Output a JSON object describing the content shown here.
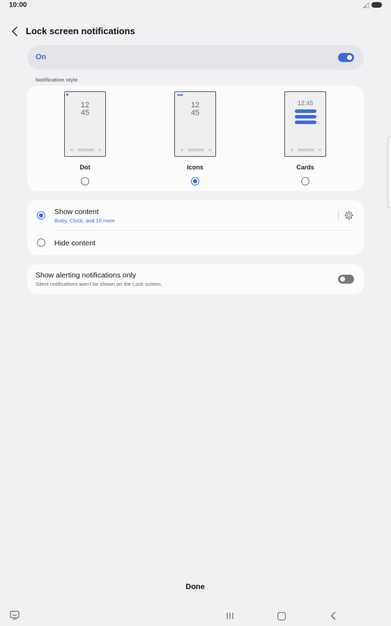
{
  "status_bar": {
    "time": "10:00"
  },
  "header": {
    "title": "Lock screen notifications"
  },
  "master_toggle": {
    "label": "On",
    "state": "on"
  },
  "notification_style": {
    "section_label": "Notification style",
    "options": [
      {
        "label": "Dot",
        "selected": false,
        "preview_clock": [
          "12",
          "45"
        ]
      },
      {
        "label": "Icons",
        "selected": true,
        "preview_clock": [
          "12",
          "45"
        ]
      },
      {
        "label": "Cards",
        "selected": false,
        "preview_clock": [
          "12:45"
        ]
      }
    ]
  },
  "content_visibility": {
    "show": {
      "title": "Show content",
      "subtitle": "Bixby, Clock, and 16 more",
      "selected": true
    },
    "hide": {
      "title": "Hide content",
      "selected": false
    }
  },
  "alerting_only": {
    "title": "Show alerting notifications only",
    "subtitle": "Silent notifications won't be shown on the Lock screen.",
    "state": "off"
  },
  "footer": {
    "done_label": "Done"
  },
  "colors": {
    "accent": "#3e6bd8",
    "background": "#f1f1f4",
    "card": "#fcfcfd"
  }
}
